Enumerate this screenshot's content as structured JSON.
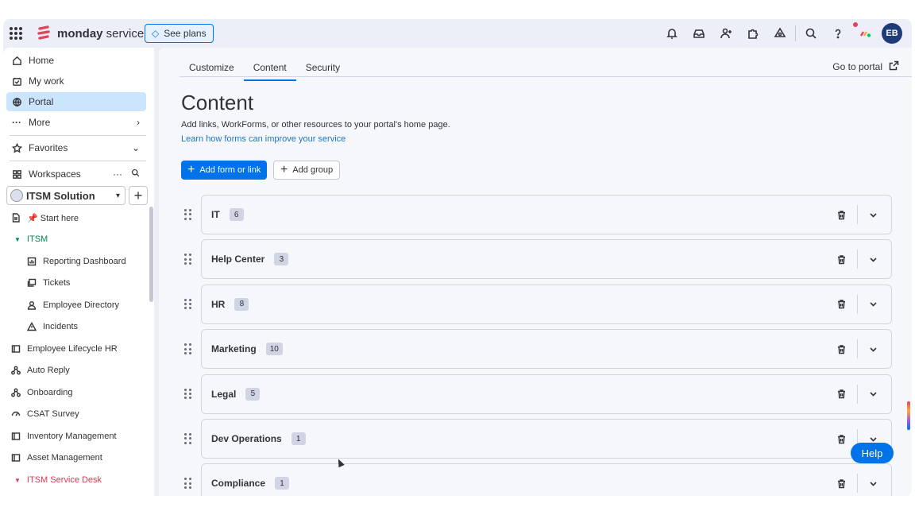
{
  "topbar": {
    "brand_bold": "monday",
    "brand_light": " service",
    "see_plans": "See plans",
    "avatar_initials": "EB",
    "icons": [
      "bell-icon",
      "inbox-icon",
      "invite-icon",
      "apps-icon",
      "integrations-icon",
      "search-icon",
      "help-icon"
    ]
  },
  "sidebar": {
    "nav": [
      {
        "label": "Home",
        "icon": "home-icon"
      },
      {
        "label": "My work",
        "icon": "my-work-icon"
      },
      {
        "label": "Portal",
        "icon": "globe-icon",
        "active": true
      },
      {
        "label": "More",
        "icon": "dots-icon"
      }
    ],
    "favorites": "Favorites",
    "workspaces": "Workspaces",
    "workspace_name": "ITSM Solution",
    "tree": [
      {
        "label": "📌 Start here",
        "type": "doc"
      },
      {
        "label": "ITSM",
        "type": "group-green"
      },
      {
        "label": "Reporting Dashboard",
        "type": "dashboard"
      },
      {
        "label": "Tickets",
        "type": "tickets"
      },
      {
        "label": "Employee Directory",
        "type": "people"
      },
      {
        "label": "Incidents",
        "type": "warning"
      },
      {
        "label": "Employee Lifecycle HR",
        "type": "board"
      },
      {
        "label": "Auto Reply",
        "type": "flow"
      },
      {
        "label": "Onboarding",
        "type": "flow"
      },
      {
        "label": "CSAT Survey",
        "type": "survey"
      },
      {
        "label": "Inventory Management",
        "type": "board"
      },
      {
        "label": "Asset Management",
        "type": "board"
      },
      {
        "label": "ITSM Service Desk",
        "type": "group-red"
      }
    ]
  },
  "main": {
    "tabs": [
      {
        "label": "Customize"
      },
      {
        "label": "Content",
        "active": true
      },
      {
        "label": "Security"
      }
    ],
    "go_to_portal": "Go to portal",
    "title": "Content",
    "description": "Add links, WorkForms, or other resources to your portal's home page.",
    "learn_link": "Learn how forms can improve your service",
    "add_form_button": "Add form or link",
    "add_group_button": "Add group",
    "groups": [
      {
        "name": "IT",
        "count": "6"
      },
      {
        "name": "Help Center",
        "count": "3"
      },
      {
        "name": "HR",
        "count": "8"
      },
      {
        "name": "Marketing",
        "count": "10"
      },
      {
        "name": "Legal",
        "count": "5"
      },
      {
        "name": "Dev Operations",
        "count": "1"
      },
      {
        "name": "Compliance",
        "count": "1"
      }
    ]
  },
  "help_button": "Help",
  "colors": {
    "accent": "#0073ea",
    "active_nav": "#cce5ff",
    "group_green": "#00854d",
    "group_red": "#d83a52"
  }
}
